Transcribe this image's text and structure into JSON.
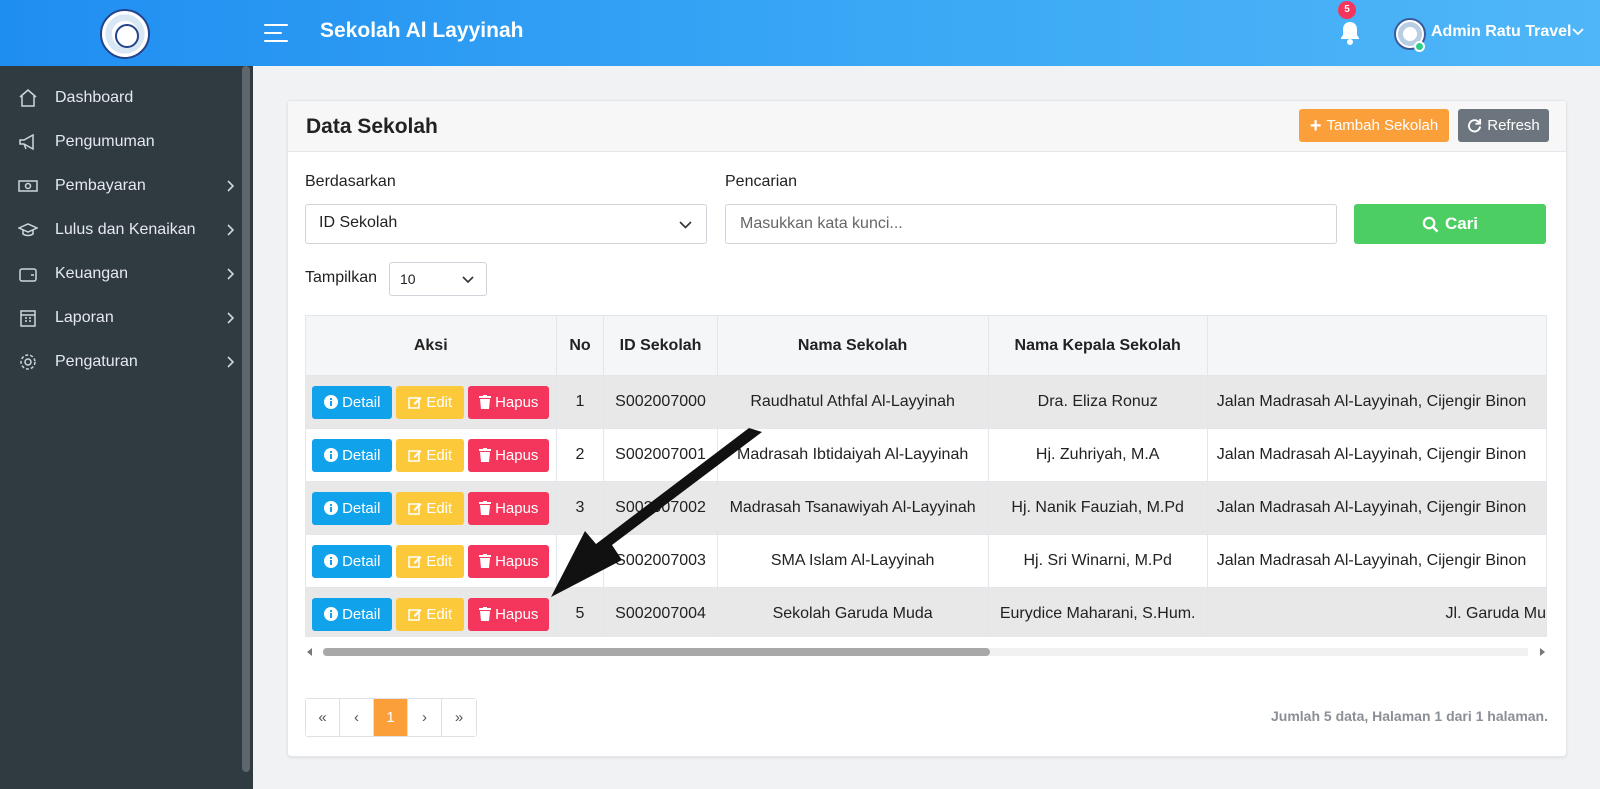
{
  "header": {
    "app_title": "Sekolah Al Layyinah",
    "notification_count": "5",
    "user_name": "Admin Ratu Travel"
  },
  "sidebar": {
    "items": [
      {
        "label": "Dashboard",
        "icon": "home-icon",
        "has_submenu": false
      },
      {
        "label": "Pengumuman",
        "icon": "megaphone-icon",
        "has_submenu": false
      },
      {
        "label": "Pembayaran",
        "icon": "money-icon",
        "has_submenu": true
      },
      {
        "label": "Lulus dan Kenaikan",
        "icon": "graduation-cap-icon",
        "has_submenu": true
      },
      {
        "label": "Keuangan",
        "icon": "wallet-icon",
        "has_submenu": true
      },
      {
        "label": "Laporan",
        "icon": "calendar-icon",
        "has_submenu": true
      },
      {
        "label": "Pengaturan",
        "icon": "gear-icon",
        "has_submenu": true
      }
    ]
  },
  "card": {
    "title": "Data Sekolah",
    "add_button": "Tambah Sekolah",
    "refresh_button": "Refresh"
  },
  "filter": {
    "by_label": "Berdasarkan",
    "by_value": "ID Sekolah",
    "search_label": "Pencarian",
    "search_placeholder": "Masukkan kata kunci...",
    "search_button": "Cari",
    "show_label": "Tampilkan",
    "show_value": "10"
  },
  "table": {
    "headers": [
      "Aksi",
      "No",
      "ID Sekolah",
      "Nama Sekolah",
      "Nama Kepala Sekolah",
      ""
    ],
    "action_labels": {
      "detail": "Detail",
      "edit": "Edit",
      "delete": "Hapus"
    },
    "rows": [
      {
        "no": "1",
        "id": "S002007000",
        "name": "Raudhatul Athfal Al-Layyinah",
        "head": "Dra. Eliza Ronuz",
        "address": "Jalan Madrasah Al-Layyinah, Cijengir Binon"
      },
      {
        "no": "2",
        "id": "S002007001",
        "name": "Madrasah Ibtidaiyah Al-Layyinah",
        "head": "Hj. Zuhriyah, M.A",
        "address": "Jalan Madrasah Al-Layyinah, Cijengir Binon"
      },
      {
        "no": "3",
        "id": "S002007002",
        "name": "Madrasah Tsanawiyah Al-Layyinah",
        "head": "Hj. Nanik Fauziah, M.Pd",
        "address": "Jalan Madrasah Al-Layyinah, Cijengir Binon"
      },
      {
        "no": "4",
        "id": "S002007003",
        "name": "SMA Islam Al-Layyinah",
        "head": "Hj. Sri Winarni, M.Pd",
        "address": "Jalan Madrasah Al-Layyinah, Cijengir Binon"
      },
      {
        "no": "5",
        "id": "S002007004",
        "name": "Sekolah Garuda Muda",
        "head": "Eurydice Maharani, S.Hum.",
        "address": "Jl. Garuda Mu"
      }
    ]
  },
  "pagination": {
    "first": "«",
    "prev": "‹",
    "current": "1",
    "next": "›",
    "last": "»",
    "info": "Jumlah 5 data, Halaman 1 dari 1 halaman."
  },
  "colors": {
    "accent_orange": "#fb9f3b",
    "search_green": "#4cce63",
    "info_blue": "#11a2ec",
    "edit_yellow": "#fcc93b",
    "danger_red": "#f5365c",
    "sidebar_bg": "#2f3a41"
  }
}
